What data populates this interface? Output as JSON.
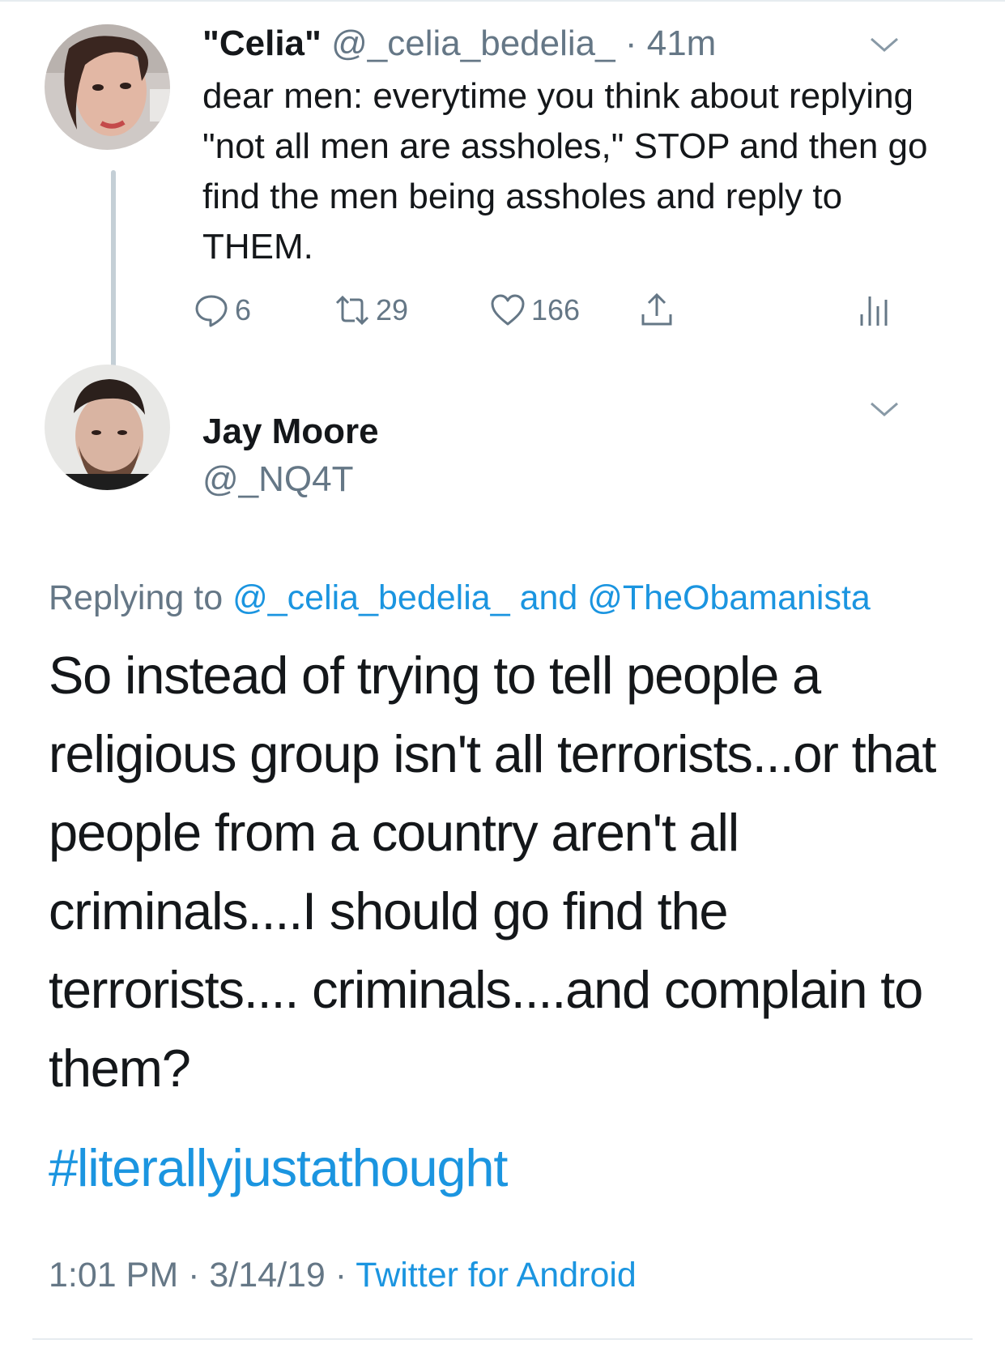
{
  "colors": {
    "accent": "#1b95e0",
    "muted": "#657786",
    "text": "#14171a",
    "thread_line": "#c4cfd6"
  },
  "parent_tweet": {
    "display_name": "\"Celia\"",
    "handle": "@_celia_bedelia_",
    "separator": "·",
    "time": "41m",
    "text": "dear men: everytime you think about replying \"not all men are assholes,\" STOP and then go find the men being assholes and reply to THEM.",
    "avatar_icon": "user-avatar-woman",
    "actions": {
      "reply_icon": "reply-icon",
      "reply_count": "6",
      "retweet_icon": "retweet-icon",
      "retweet_count": "29",
      "like_icon": "heart-icon",
      "like_count": "166",
      "share_icon": "share-icon",
      "analytics_icon": "analytics-icon"
    }
  },
  "reply_tweet": {
    "display_name": "Jay Moore",
    "handle": "@_NQ4T",
    "avatar_icon": "user-avatar-man",
    "replying_prefix": "Replying to",
    "replying_user1": "@_celia_bedelia_",
    "replying_and": "and",
    "replying_user2": "@TheObamanista",
    "text": "So instead of trying to tell people a religious group isn't all terrorists...or that people from a country aren't all criminals....I should go find the terrorists.... criminals....and complain to them?",
    "hashtag": "#literallyjustathought",
    "time": "1:01 PM",
    "date": "3/14/19",
    "separator": "·",
    "source": "Twitter for Android"
  }
}
